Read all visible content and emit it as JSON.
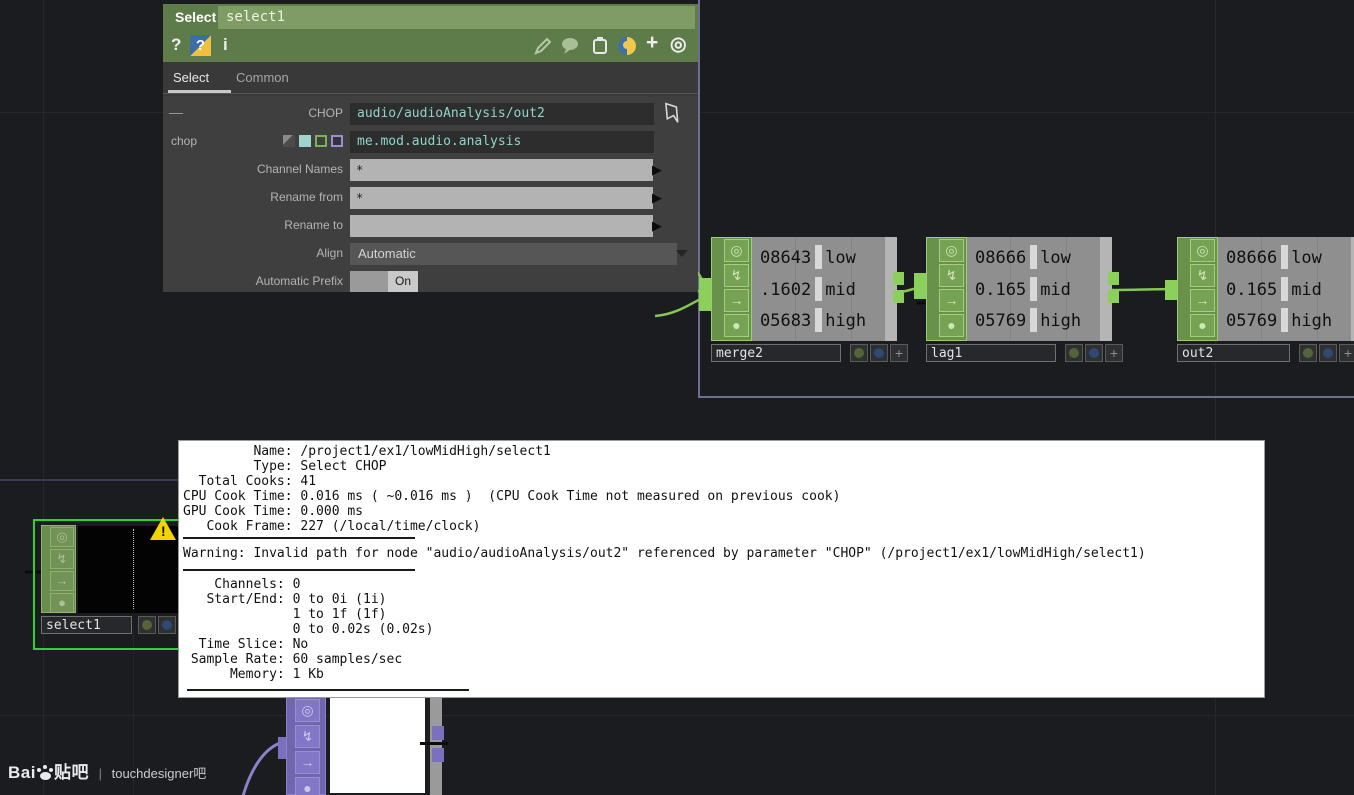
{
  "colors": {
    "bg": "#1a1c20",
    "grid": "#25272d",
    "guide": "#6b7092",
    "guide-dim": "#353b58",
    "header-green": "#5d7c4a",
    "field-green": "#7e9c63",
    "dialog-bg": "#3f3f3f",
    "tab-bar": "#393939",
    "dark-field": "#2d2d2d",
    "teal": "#8fd4c8",
    "light-field": "#b3b3b3",
    "dropdown": "#565656",
    "label-gray": "#b4b4b4",
    "flag-col": "#69914c",
    "flag-box": "#76a353",
    "flag-icon": "#d2e4ba",
    "node-body": "#8f8f8f",
    "node-strip": "#b5b5b5",
    "connector": "#8ad05a",
    "wire-green": "#85c654",
    "wire-purple": "#8d80cc",
    "selection-green": "#2bd52b",
    "warning-yellow": "#f2d500",
    "name-bg": "#26282b",
    "purple-col": "#7a70bf",
    "popup-bg": "#ffffff",
    "popup-text": "#111111"
  },
  "dialog": {
    "family": "Select",
    "name": "select1",
    "help_label": "?",
    "python_help_label": "?",
    "info_label": "i",
    "tabs": [
      {
        "label": "Select"
      },
      {
        "label": "Common"
      }
    ],
    "collapse_glyph": "—",
    "rows": {
      "chop_ref": {
        "label": "CHOP",
        "value": "audio/audioAnalysis/out2"
      },
      "chop_expr": {
        "label": "chop",
        "value": "me.mod.audio.analysis"
      },
      "channel_names": {
        "label": "Channel Names",
        "value": "*"
      },
      "rename_from": {
        "label": "Rename from",
        "value": "*"
      },
      "rename_to": {
        "label": "Rename to",
        "value": ""
      },
      "align": {
        "label": "Align",
        "value": "Automatic"
      },
      "auto_prefix": {
        "label": "Automatic Prefix",
        "value": "On"
      }
    }
  },
  "nodes": {
    "merge2": {
      "name": "merge2",
      "channels": [
        {
          "value": "08643",
          "label": "low"
        },
        {
          "value": ".1602",
          "label": "mid"
        },
        {
          "value": "05683",
          "label": "high"
        }
      ]
    },
    "lag1": {
      "name": "lag1",
      "channels": [
        {
          "value": "08666",
          "label": "low"
        },
        {
          "value": "0.165",
          "label": "mid"
        },
        {
          "value": "05769",
          "label": "high"
        }
      ]
    },
    "out2": {
      "name": "out2",
      "channels": [
        {
          "value": "08666",
          "label": "low"
        },
        {
          "value": "0.165",
          "label": "mid"
        },
        {
          "value": "05769",
          "label": "high"
        }
      ]
    },
    "select1": {
      "name": "select1"
    }
  },
  "flag_glyphs": {
    "viewer": "◎",
    "cook": "↯",
    "export": "→",
    "bypass": "●",
    "plus": "+"
  },
  "info_popup": {
    "cook_info": [
      "         Name: /project1/ex1/lowMidHigh/select1",
      "         Type: Select CHOP",
      "  Total Cooks: 41",
      "CPU Cook Time: 0.016 ms ( ~0.016 ms )  (CPU Cook Time not measured on previous cook)",
      "GPU Cook Time: 0.000 ms",
      "   Cook Frame: 227 (/local/time/clock)"
    ],
    "warning": "Warning: Invalid path for node \"audio/audioAnalysis/out2\" referenced by parameter \"CHOP\" (/project1/ex1/lowMidHigh/select1)",
    "channel_info": [
      "    Channels: 0",
      "   Start/End: 0 to 0i (1i)",
      "              1 to 1f (1f)",
      "              0 to 0.02s (0.02s)",
      "  Time Slice: No",
      " Sample Rate: 60 samples/sec",
      "      Memory: 1 Kb"
    ]
  },
  "watermark": {
    "brand": "Bai",
    "brand_cn": "贴吧",
    "separator": "|",
    "text": "touchdesigner吧"
  }
}
